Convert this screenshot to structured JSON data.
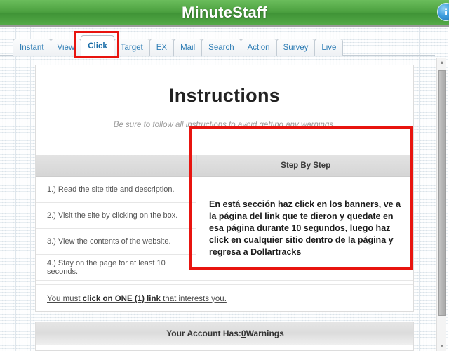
{
  "titlebar": {
    "title": "MinuteStaff",
    "corner_icon": "info-badge-icon",
    "green": "#4ba03f"
  },
  "tabs": [
    {
      "label": "Instant",
      "active": false
    },
    {
      "label": "View",
      "active": false
    },
    {
      "label": "Click",
      "active": true
    },
    {
      "label": "Target",
      "active": false
    },
    {
      "label": "EX",
      "active": false
    },
    {
      "label": "Mail",
      "active": false
    },
    {
      "label": "Search",
      "active": false
    },
    {
      "label": "Action",
      "active": false
    },
    {
      "label": "Survey",
      "active": false
    },
    {
      "label": "Live",
      "active": false
    }
  ],
  "content": {
    "title": "Instructions",
    "subtitle": "Be sure to follow all instructions to avoid getting any warnings.",
    "table_header_blank": "",
    "table_header_right": "Step By Step",
    "steps": [
      "1.) Read the site title and description.",
      "2.) Visit the site by clicking on the box.",
      "3.) View the contents of the website.",
      "4.) Stay on the page for at least 10 seconds."
    ],
    "note": "En está sección haz click en los banners, ve a la página del link que te dieron y quedate en esa página durante 10 segundos, luego haz click en cualquier sitio dentro de la página y regresa a Dollartracks",
    "link_prefix": "You must ",
    "link_bold": "click on ONE (1) link",
    "link_suffix": " that interests you."
  },
  "annotation": {
    "color": "#e8140f",
    "tab_highlight_target": "Click"
  },
  "account": {
    "prefix": "Your Account Has: ",
    "count": "0",
    "suffix": " Warnings"
  },
  "scrollbar": {
    "up_arrow": "▲",
    "down_arrow": "▼"
  }
}
